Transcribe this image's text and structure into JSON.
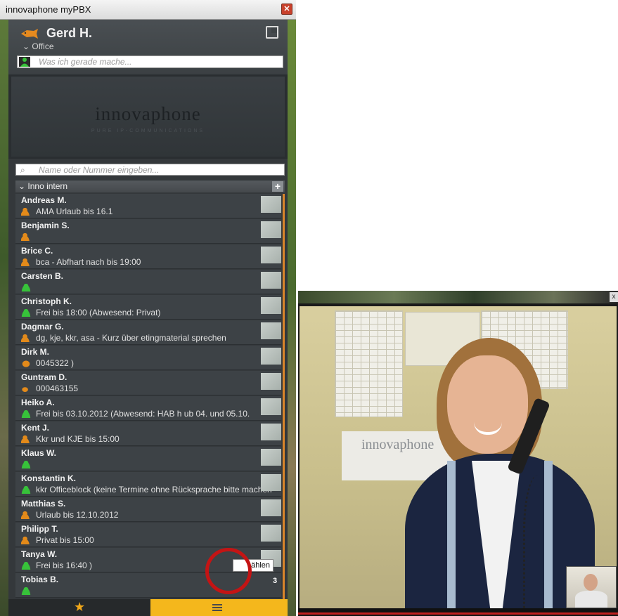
{
  "window": {
    "title": "innovaphone myPBX"
  },
  "user": {
    "name": "Gerd H.",
    "location": "Office",
    "status_placeholder": "Was ich gerade mache..."
  },
  "banner": {
    "brand": "innovaphone",
    "tagline": "PURE IP-COMMUNICATIONS"
  },
  "search": {
    "placeholder": "Name oder Nummer eingeben..."
  },
  "group": {
    "label": "Inno intern",
    "add": "+"
  },
  "contacts": [
    {
      "name": "Andreas M.",
      "note": "AMA Urlaub bis 16.1",
      "status": "away"
    },
    {
      "name": "Benjamin S.",
      "note": "",
      "status": "away"
    },
    {
      "name": "Brice C.",
      "note": "bca - Abfhart nach              bis 19:00",
      "status": "away"
    },
    {
      "name": "Carsten B.",
      "note": "",
      "status": "available"
    },
    {
      "name": "Christoph K.",
      "note": "Frei bis 18:00 (Abwesend: Privat)",
      "status": "available"
    },
    {
      "name": "Dagmar G.",
      "note": "dg, kje, kkr, asa - Kurz über               etingmaterial sprechen",
      "status": "away"
    },
    {
      "name": "Dirk M.",
      "note": "0045322        )",
      "status": "bell"
    },
    {
      "name": "Guntram D.",
      "note": "000463155",
      "status": "phone"
    },
    {
      "name": "Heiko A.",
      "note": "Frei bis 03.10.2012 (Abwesend: HAB h        ub 04. und 05.10.",
      "status": "available"
    },
    {
      "name": "Kent J.",
      "note": "Kkr und KJE                        bis 15:00",
      "status": "away"
    },
    {
      "name": "Klaus W.",
      "note": "",
      "status": "available"
    },
    {
      "name": "Konstantin K.",
      "note": "kkr Officeblock (keine Termine ohne Rücksprache bitte machen",
      "status": "available"
    },
    {
      "name": "Matthias S.",
      "note": "Urlaub bis 12.10.2012",
      "status": "away"
    },
    {
      "name": "Philipp T.",
      "note": "Privat bis 15:00",
      "status": "away"
    },
    {
      "name": "Tanya W.",
      "note": "Frei bis 16:40             )",
      "status": "available"
    },
    {
      "name": "Tobias B.",
      "note": "",
      "status": "available"
    }
  ],
  "call_tooltip": "ählen",
  "badge": "3",
  "video": {
    "sign_text": "innovaphone",
    "close": "x"
  },
  "colors": {
    "accent": "#f4b71c",
    "marker": "#c41414",
    "available": "#37c23a",
    "away": "#e38a1a"
  },
  "icons": {
    "fav_tab": "star-icon",
    "list_tab": "list-icon"
  }
}
